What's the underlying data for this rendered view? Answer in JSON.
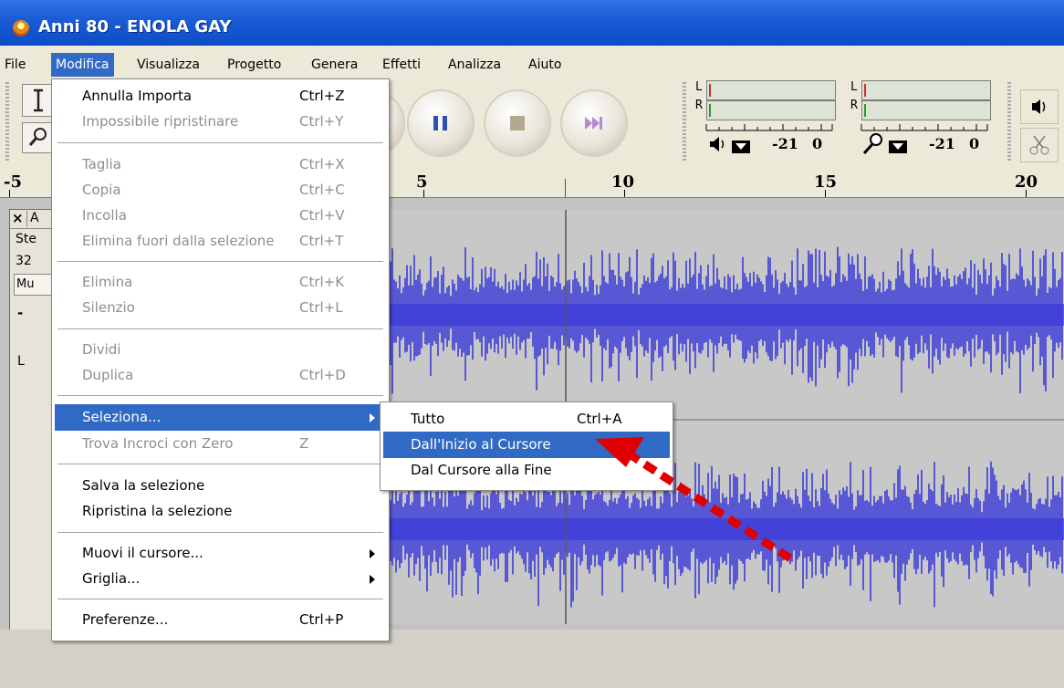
{
  "window": {
    "title": "Anni 80 - ENOLA GAY"
  },
  "menubar": {
    "items": [
      "File",
      "Modifica",
      "Visualizza",
      "Progetto",
      "Genera",
      "Effetti",
      "Analizza",
      "Aiuto"
    ]
  },
  "meters": {
    "playback": {
      "l": "L",
      "r": "R",
      "scale_a": "-21",
      "scale_b": "0"
    },
    "record": {
      "l": "L",
      "r": "R",
      "scale_a": "-21",
      "scale_b": "0"
    }
  },
  "ruler": {
    "labels": [
      "-5",
      "5",
      "10",
      "15",
      "20"
    ]
  },
  "track": {
    "close_label": "×",
    "name_fragment": "A",
    "info1": "Ste",
    "info2": "32",
    "mute_fragment": "Mu",
    "gain_fragment": "-",
    "pan_fragment": "L"
  },
  "modifica_menu": {
    "undo": {
      "label": "Annulla Importa",
      "shortcut": "Ctrl+Z"
    },
    "redo": {
      "label": "Impossibile ripristinare",
      "shortcut": "Ctrl+Y"
    },
    "cut": {
      "label": "Taglia",
      "shortcut": "Ctrl+X"
    },
    "copy": {
      "label": "Copia",
      "shortcut": "Ctrl+C"
    },
    "paste": {
      "label": "Incolla",
      "shortcut": "Ctrl+V"
    },
    "trim": {
      "label": "Elimina fuori dalla selezione",
      "shortcut": "Ctrl+T"
    },
    "delete": {
      "label": "Elimina",
      "shortcut": "Ctrl+K"
    },
    "silence": {
      "label": "Silenzio",
      "shortcut": "Ctrl+L"
    },
    "split": {
      "label": "Dividi"
    },
    "duplicate": {
      "label": "Duplica",
      "shortcut": "Ctrl+D"
    },
    "select": {
      "label": "Seleziona..."
    },
    "find_zero": {
      "label": "Trova Incroci con Zero",
      "shortcut": "Z"
    },
    "save_sel": {
      "label": "Salva la selezione"
    },
    "restore_sel": {
      "label": "Ripristina la selezione"
    },
    "move_cursor": {
      "label": "Muovi il cursore..."
    },
    "grid": {
      "label": "Griglia..."
    },
    "prefs": {
      "label": "Preferenze...",
      "shortcut": "Ctrl+P"
    }
  },
  "select_submenu": {
    "all": {
      "label": "Tutto",
      "shortcut": "Ctrl+A"
    },
    "start_to_cursor": {
      "label": "Dall'Inizio al Cursore"
    },
    "cursor_to_end": {
      "label": "Dal Cursore alla Fine"
    }
  },
  "colors": {
    "titlebar": "#0c4cc8",
    "highlight": "#316ac5",
    "waveform": "#3c3cd8",
    "arrow": "#e00000"
  }
}
